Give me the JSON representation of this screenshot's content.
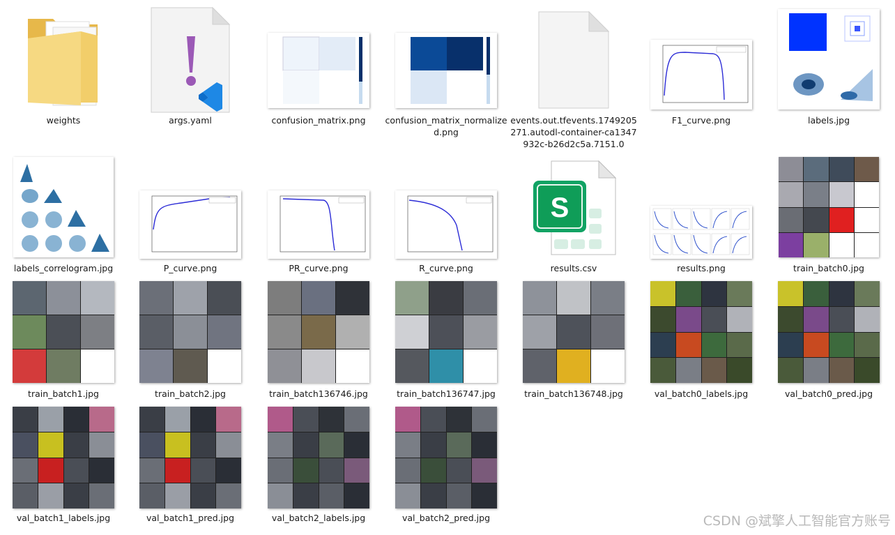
{
  "files": [
    {
      "name": "weights"
    },
    {
      "name": "args.yaml"
    },
    {
      "name": "confusion_matrix.png"
    },
    {
      "name": "confusion_matrix_normalized.png"
    },
    {
      "name": "events.out.tfevents.1749205271.autodl-container-ca1347932c-b26d2c5a.7151.0"
    },
    {
      "name": "F1_curve.png"
    },
    {
      "name": "labels.jpg"
    },
    {
      "name": "labels_correlogram.jpg"
    },
    {
      "name": "P_curve.png"
    },
    {
      "name": "PR_curve.png"
    },
    {
      "name": "R_curve.png"
    },
    {
      "name": "results.csv"
    },
    {
      "name": "results.png"
    },
    {
      "name": "train_batch0.jpg"
    },
    {
      "name": "train_batch1.jpg"
    },
    {
      "name": "train_batch2.jpg"
    },
    {
      "name": "train_batch136746.jpg"
    },
    {
      "name": "train_batch136747.jpg"
    },
    {
      "name": "train_batch136748.jpg"
    },
    {
      "name": "val_batch0_labels.jpg"
    },
    {
      "name": "val_batch0_pred.jpg"
    },
    {
      "name": "val_batch1_labels.jpg"
    },
    {
      "name": "val_batch1_pred.jpg"
    },
    {
      "name": "val_batch2_labels.jpg"
    },
    {
      "name": "val_batch2_pred.jpg"
    }
  ],
  "icons": {
    "folder": "folder-icon",
    "yaml": "vscode-file-icon",
    "csv": "spreadsheet-icon",
    "blank": "blank-file-icon"
  },
  "watermark": "CSDN @斌擎人工智能官方账号"
}
